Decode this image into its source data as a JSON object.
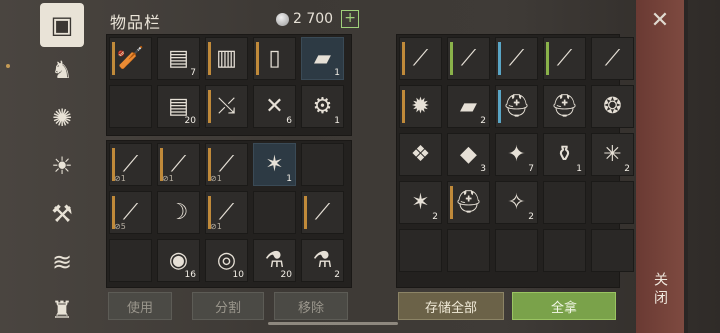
{
  "header": {
    "title": "物品栏",
    "coins": "2 700",
    "plus": "+"
  },
  "close": {
    "label": "关闭",
    "x": "✕"
  },
  "sidebar": [
    {
      "icon": "chest-icon",
      "glyph": "▣"
    },
    {
      "icon": "wolf-icon",
      "glyph": "♞"
    },
    {
      "icon": "skill-icon",
      "glyph": "✺"
    },
    {
      "icon": "map-sun-icon",
      "glyph": "☀"
    },
    {
      "icon": "hammer-icon",
      "glyph": "⚒"
    },
    {
      "icon": "scroll-icon",
      "glyph": "≋"
    },
    {
      "icon": "character-icon",
      "glyph": "♜"
    }
  ],
  "left_grid_top": [
    {
      "name": "spiked-club",
      "glyph": "🏏",
      "count": "",
      "lv": "orange"
    },
    {
      "name": "cloth",
      "glyph": "▤",
      "count": "7",
      "lv": ""
    },
    {
      "name": "leather-armor",
      "glyph": "▥",
      "count": "",
      "lv": "orange"
    },
    {
      "name": "leather-pants",
      "glyph": "▯",
      "count": "",
      "lv": "orange"
    },
    {
      "name": "wood-planks",
      "glyph": "▰",
      "count": "1",
      "lv": "",
      "sel": true
    },
    {
      "name": "",
      "glyph": "",
      "count": "",
      "lv": ""
    },
    {
      "name": "cloth-stack",
      "glyph": "▤",
      "count": "20",
      "lv": ""
    },
    {
      "name": "crossbow",
      "glyph": "⤯",
      "count": "",
      "lv": "orange"
    },
    {
      "name": "bolts",
      "glyph": "✕",
      "count": "6",
      "lv": ""
    },
    {
      "name": "gear",
      "glyph": "⚙",
      "count": "1",
      "lv": ""
    }
  ],
  "left_grid_bottom": [
    {
      "name": "sword",
      "glyph": "⟋",
      "count": "",
      "lv": "orange",
      "dur": "⊘1"
    },
    {
      "name": "halberd",
      "glyph": "⟋",
      "count": "",
      "lv": "orange",
      "dur": "⊘1"
    },
    {
      "name": "halberd",
      "glyph": "⟋",
      "count": "",
      "lv": "orange",
      "dur": "⊘1"
    },
    {
      "name": "thorn-branches",
      "glyph": "✶",
      "count": "1",
      "lv": "",
      "sel": true
    },
    {
      "name": "",
      "glyph": "",
      "count": "",
      "lv": ""
    },
    {
      "name": "halberd",
      "glyph": "⟋",
      "count": "",
      "lv": "orange",
      "dur": "⊘5"
    },
    {
      "name": "scimitar",
      "glyph": "☽",
      "count": "",
      "lv": ""
    },
    {
      "name": "sword",
      "glyph": "⟋",
      "count": "",
      "lv": "orange",
      "dur": "⊘1"
    },
    {
      "name": "",
      "glyph": "",
      "count": "",
      "lv": ""
    },
    {
      "name": "falchion",
      "glyph": "⟋",
      "count": "",
      "lv": "orange"
    },
    {
      "name": "",
      "glyph": "",
      "count": "",
      "lv": ""
    },
    {
      "name": "bread",
      "glyph": "◉",
      "count": "16",
      "lv": ""
    },
    {
      "name": "bandage",
      "glyph": "◎",
      "count": "10",
      "lv": ""
    },
    {
      "name": "potion",
      "glyph": "⚗",
      "count": "20",
      "lv": ""
    },
    {
      "name": "potion",
      "glyph": "⚗",
      "count": "2",
      "lv": ""
    }
  ],
  "right_grid": [
    {
      "name": "halberd",
      "glyph": "⟋",
      "count": "",
      "lv": "orange"
    },
    {
      "name": "green-spear",
      "glyph": "⟋",
      "count": "",
      "lv": "green"
    },
    {
      "name": "blue-sword",
      "glyph": "⟋",
      "count": "",
      "lv": "blue"
    },
    {
      "name": "spear",
      "glyph": "⟋",
      "count": "",
      "lv": "green"
    },
    {
      "name": "poleaxe",
      "glyph": "⟋",
      "count": "",
      "lv": ""
    },
    {
      "name": "book",
      "glyph": "✹",
      "count": "",
      "lv": "orange"
    },
    {
      "name": "wood-plank",
      "glyph": "▰",
      "count": "2",
      "lv": ""
    },
    {
      "name": "helmet",
      "glyph": "⛑",
      "count": "",
      "lv": "blue"
    },
    {
      "name": "great-helm",
      "glyph": "⛑",
      "count": "",
      "lv": ""
    },
    {
      "name": "thorn-crown",
      "glyph": "❂",
      "count": "",
      "lv": ""
    },
    {
      "name": "scroll",
      "glyph": "❖",
      "count": "",
      "lv": ""
    },
    {
      "name": "silver-ore",
      "glyph": "◆",
      "count": "3",
      "lv": ""
    },
    {
      "name": "blue-crystal",
      "glyph": "✦",
      "count": "7",
      "lv": ""
    },
    {
      "name": "bottle",
      "glyph": "⚱",
      "count": "1",
      "lv": ""
    },
    {
      "name": "ice-potion",
      "glyph": "✳",
      "count": "2",
      "lv": ""
    },
    {
      "name": "thorn-branches",
      "glyph": "✶",
      "count": "2",
      "lv": ""
    },
    {
      "name": "iron-mask",
      "glyph": "⛑",
      "count": "",
      "lv": "orange"
    },
    {
      "name": "map-scroll",
      "glyph": "✧",
      "count": "2",
      "lv": ""
    }
  ],
  "buttons": {
    "use": "使用",
    "split": "分割",
    "remove": "移除",
    "store_all": "存储全部",
    "take_all": "全拿"
  }
}
